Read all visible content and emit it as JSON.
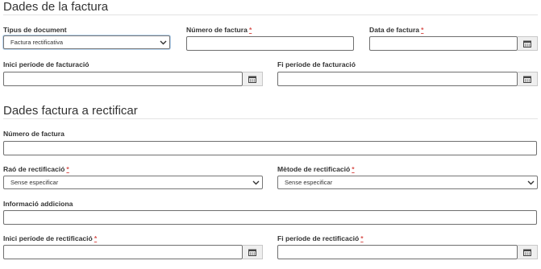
{
  "section1": {
    "title": "Dades de la factura",
    "tipus_document": {
      "label": "Tipus de document",
      "value": "Factura rectificativa"
    },
    "numero_factura": {
      "label": "Número de factura",
      "required_mark": "*",
      "value": ""
    },
    "data_factura": {
      "label": "Data de factura",
      "required_mark": "*",
      "value": ""
    },
    "inici_periode": {
      "label": "Inici període de facturació",
      "value": ""
    },
    "fi_periode": {
      "label": "Fi període de facturació",
      "value": ""
    }
  },
  "section2": {
    "title": "Dades factura a rectificar",
    "numero_factura": {
      "label": "Número de factura",
      "value": ""
    },
    "rao_rectificacio": {
      "label": "Raó de rectificació",
      "required_mark": "*",
      "value": "Sense especificar"
    },
    "metode_rectificacio": {
      "label": "Mètode de rectificació",
      "required_mark": "*",
      "value": "Sense especificar"
    },
    "informacio_addiciona": {
      "label": "Informació addiciona",
      "value": ""
    },
    "inici_periode_rectificacio": {
      "label": "Inici període de rectificació",
      "required_mark": "*",
      "value": ""
    },
    "fi_periode_rectificacio": {
      "label": "Fi període de rectificació",
      "required_mark": "*",
      "value": ""
    }
  },
  "icons": {
    "calendar": "calendar-icon",
    "dropdown": "chevron-down-icon"
  },
  "colors": {
    "required": "#d9534f",
    "focus_border": "#5b9bd5"
  }
}
